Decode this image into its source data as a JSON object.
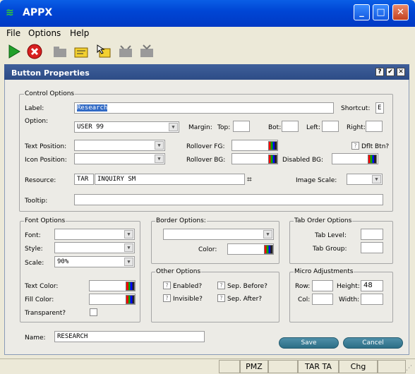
{
  "app": {
    "title": "APPX"
  },
  "menu": [
    "File",
    "Options",
    "Help"
  ],
  "toolbar": {
    "icons": [
      "run-icon",
      "cancel-icon",
      "folder-icon",
      "edit-icon",
      "pointer-icon",
      "box-icon",
      "tv-icon"
    ]
  },
  "dialog": {
    "title": "Button Properties",
    "control": {
      "legend": "Control Options",
      "label_lbl": "Label:",
      "label_val": "Research",
      "shortcut_lbl": "Shortcut:",
      "shortcut_val": "E",
      "option_lbl": "Option:",
      "option_val": "USER 99",
      "margin_lbl": "Margin:",
      "top_lbl": "Top:",
      "bot_lbl": "Bot:",
      "left_lbl": "Left:",
      "right_lbl": "Right:",
      "textpos_lbl": "Text Position:",
      "rolloverfg_lbl": "Rollover FG:",
      "dflt_lbl": "Dflt Btn?",
      "iconpos_lbl": "Icon Position:",
      "rolloverbg_lbl": "Rollover BG:",
      "disabledbg_lbl": "Disabled BG:",
      "resource_lbl": "Resource:",
      "resource_app": "TAR",
      "resource_name": "INQUIRY SM",
      "imagescale_lbl": "Image Scale:",
      "tooltip_lbl": "Tooltip:"
    },
    "font": {
      "legend": "Font Options",
      "font_lbl": "Font:",
      "style_lbl": "Style:",
      "scale_lbl": "Scale:",
      "scale_val": "90%",
      "textcolor_lbl": "Text Color:",
      "fillcolor_lbl": "Fill Color:",
      "transparent_lbl": "Transparent?"
    },
    "border": {
      "legend": "Border Options:",
      "color_lbl": "Color:"
    },
    "taborder": {
      "legend": "Tab Order Options",
      "level_lbl": "Tab Level:",
      "group_lbl": "Tab Group:"
    },
    "other": {
      "legend": "Other Options",
      "enabled_lbl": "Enabled?",
      "invisible_lbl": "Invisible?",
      "sepbefore_lbl": "Sep. Before?",
      "sepafter_lbl": "Sep. After?"
    },
    "micro": {
      "legend": "Micro Adjustments",
      "row_lbl": "Row:",
      "height_lbl": "Height:",
      "height_val": "48",
      "col_lbl": "Col:",
      "width_lbl": "Width:"
    },
    "name_lbl": "Name:",
    "name_val": "RESEARCH",
    "save_label": "Save",
    "cancel_label": "Cancel"
  },
  "status": [
    "PMZ",
    "TAR TA",
    "Chg"
  ]
}
